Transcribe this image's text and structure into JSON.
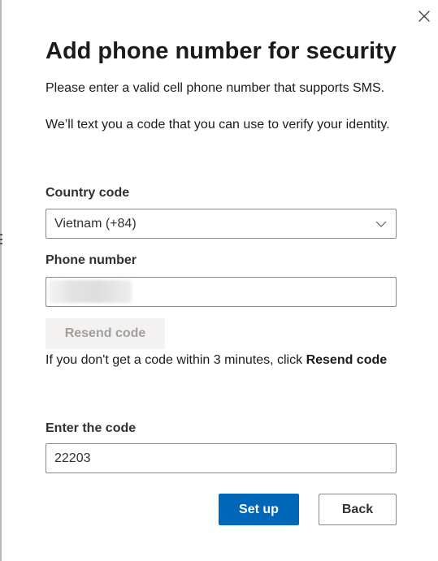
{
  "dialog": {
    "title": "Add phone number for security",
    "description": "Please enter a valid cell phone number that supports SMS.",
    "info": "We’ll text you a code that you can use to verify your identity.",
    "close_icon": "close-icon"
  },
  "country": {
    "label": "Country code",
    "selected": "Vietnam (+84)",
    "chevron_icon": "chevron-down-icon"
  },
  "phone": {
    "label": "Phone number",
    "value": ""
  },
  "resend": {
    "label": "Resend code",
    "hint_prefix": "If you don't get a code within 3 minutes, click ",
    "hint_link": "Resend code"
  },
  "code": {
    "label": "Enter the code",
    "value": "22203"
  },
  "actions": {
    "setup_label": "Set up",
    "back_label": "Back"
  },
  "colors": {
    "primary": "#0067b8",
    "border": "#8a8886",
    "disabled_bg": "#f3f2f1",
    "disabled_text": "#a19f9d"
  }
}
